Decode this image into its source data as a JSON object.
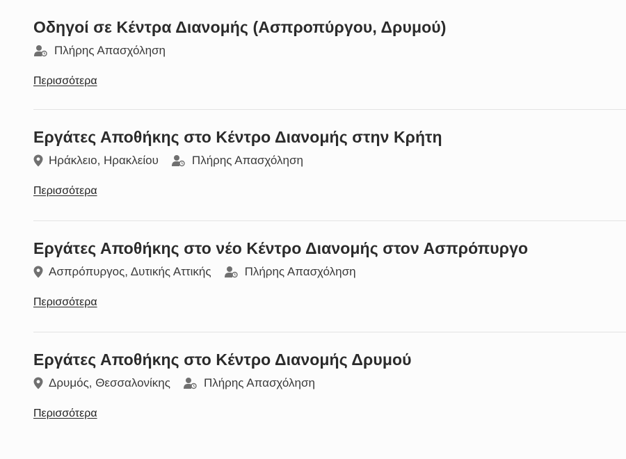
{
  "jobs": [
    {
      "title": "Οδηγοί σε Κέντρα Διανομής (Ασπροπύργου, Δρυμού)",
      "location": "",
      "employment_type": "Πλήρης Απασχόληση",
      "more_label": "Περισσότερα"
    },
    {
      "title": "Εργάτες Αποθήκης στο Κέντρο Διανομής στην Κρήτη",
      "location": "Ηράκλειο, Ηρακλείου",
      "employment_type": "Πλήρης Απασχόληση",
      "more_label": "Περισσότερα"
    },
    {
      "title": "Εργάτες Αποθήκης στο νέο Κέντρο Διανομής στον Ασπρόπυργο",
      "location": "Ασπρόπυργος, Δυτικής Αττικής",
      "employment_type": "Πλήρης Απασχόληση",
      "more_label": "Περισσότερα"
    },
    {
      "title": "Εργάτες Αποθήκης στο Κέντρο Διανομής Δρυμού",
      "location": "Δρυμός, Θεσσαλονίκης",
      "employment_type": "Πλήρης Απασχόληση",
      "more_label": "Περισσότερα"
    }
  ],
  "icons": {
    "location": "map-pin-icon",
    "employment": "user-clock-icon"
  },
  "colors": {
    "text": "#2b2b2b",
    "icon": "#707070",
    "divider": "#e3e3e3"
  }
}
